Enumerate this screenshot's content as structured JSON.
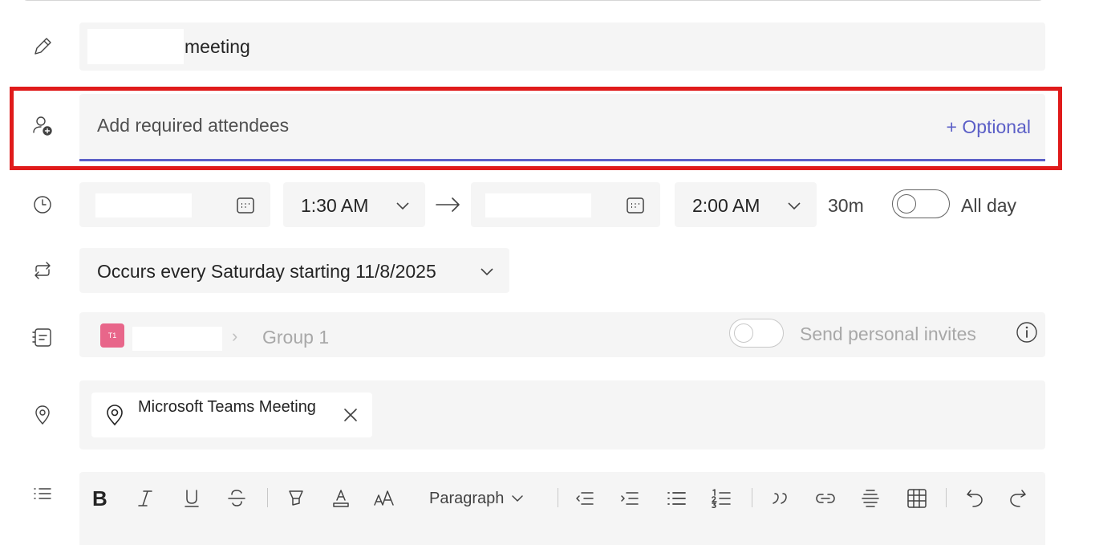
{
  "title": {
    "value": "meeting"
  },
  "attendees": {
    "placeholder": "Add required attendees",
    "optional_label": "+ Optional"
  },
  "schedule": {
    "start_time": "1:30 AM",
    "end_time": "2:00 AM",
    "duration": "30m",
    "all_day_label": "All day",
    "all_day_on": false
  },
  "recurrence": {
    "label": "Occurs every Saturday starting 11/8/2025"
  },
  "channel": {
    "team_initials": "T1",
    "channel_name": "Group 1",
    "send_invites_label": "Send personal invites",
    "send_invites_on": false
  },
  "location": {
    "chip_label": "Microsoft Teams Meeting"
  },
  "toolbar": {
    "paragraph_label": "Paragraph",
    "bold_label": "B"
  },
  "colors": {
    "accent": "#5b5fc7",
    "highlight": "#e01b1b",
    "field_bg": "#f5f5f5",
    "team_avatar": "#e8668a"
  },
  "icons": [
    "pencil-icon",
    "add-person-icon",
    "clock-icon",
    "repeat-icon",
    "channel-icon",
    "location-pin-icon",
    "list-icon",
    "calendar-icon",
    "chevron-down-icon",
    "arrow-right-icon",
    "info-icon",
    "close-icon"
  ]
}
